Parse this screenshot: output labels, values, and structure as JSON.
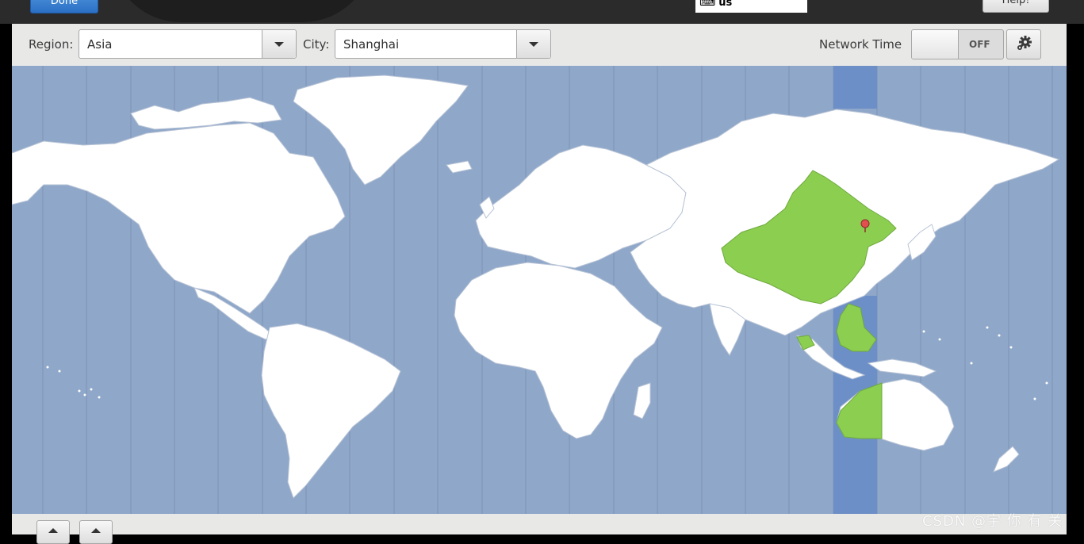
{
  "header": {
    "done_label": "Done",
    "keyboard_layout": "us",
    "help_label": "Help!"
  },
  "toolbar": {
    "region_label": "Region:",
    "region_value": "Asia",
    "city_label": "City:",
    "city_value": "Shanghai",
    "network_time_label": "Network Time",
    "network_time_state": "OFF"
  },
  "map": {
    "selected_timezone": "Asia/Shanghai",
    "ocean_color": "#8fa7c9",
    "land_color": "#ffffff",
    "highlight_color": "#8ccf50",
    "selected_band_color": "#6d8fc7",
    "pin_color": "#e24f4f"
  },
  "icons": {
    "keyboard": "keyboard-icon",
    "settings": "gear-icon",
    "dropdown": "chevron-down-icon",
    "pin": "map-pin-icon"
  },
  "watermark": "CSDN @宇 你 有 关"
}
